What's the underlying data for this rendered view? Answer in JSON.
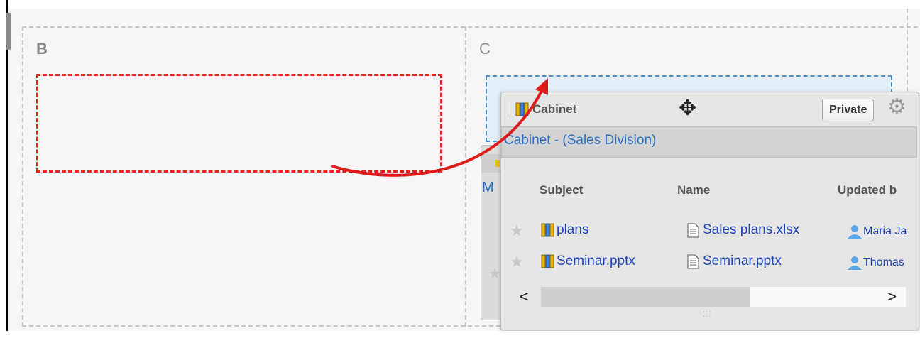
{
  "layout": {
    "column_b_label": "B",
    "column_c_label": "C"
  },
  "background_portlet": {
    "title_initial": "M"
  },
  "portlet": {
    "title": "Cabinet",
    "subtitle": "Cabinet - (Sales Division)",
    "private_button": "Private",
    "icons": [
      "cabinet-icon",
      "move-icon",
      "gear-icon",
      "star-icon",
      "file-icon",
      "user-icon"
    ],
    "columns": [
      "Subject",
      "Name",
      "Updated b"
    ],
    "rows": [
      {
        "subject": "plans",
        "name": "Sales plans.xlsx",
        "updated_by": "Maria Ja"
      },
      {
        "subject": "Seminar.pptx",
        "name": "Seminar.pptx",
        "updated_by": "Thomas"
      }
    ],
    "scroll_left": "<",
    "scroll_right": ">"
  },
  "colors": {
    "drop_target_b": "#ee2020",
    "drop_target_c": "#4a8fd0",
    "arrow": "#dd1c1c",
    "link": "#1e43c0"
  }
}
